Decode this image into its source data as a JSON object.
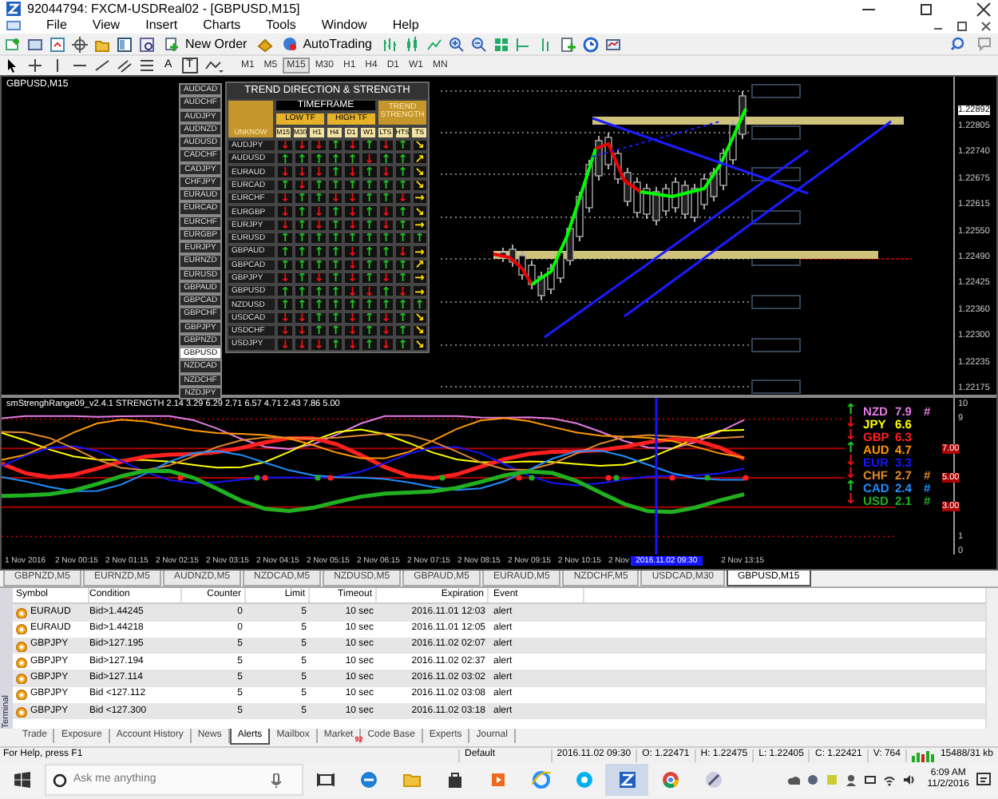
{
  "window": {
    "title": "92044794: FXCM-USDReal02 - [GBPUSD,M15]"
  },
  "menu": [
    "File",
    "View",
    "Insert",
    "Charts",
    "Tools",
    "Window",
    "Help"
  ],
  "toolbar": {
    "buttons": [
      "New Order",
      "AutoTrading"
    ],
    "text_tools": [
      "A",
      "T"
    ],
    "timeframes": [
      {
        "label": "M1",
        "selected": false
      },
      {
        "label": "M5",
        "selected": false
      },
      {
        "label": "M15",
        "selected": true
      },
      {
        "label": "M30",
        "selected": false
      },
      {
        "label": "H1",
        "selected": false
      },
      {
        "label": "H4",
        "selected": false
      },
      {
        "label": "D1",
        "selected": false
      },
      {
        "label": "W1",
        "selected": false
      },
      {
        "label": "MN",
        "selected": false
      }
    ]
  },
  "chart": {
    "symbol": "GBPUSD,M15",
    "price_axis": [
      "1.22892",
      "1.22805",
      "1.22740",
      "1.22675",
      "1.22615",
      "1.22550",
      "1.22490",
      "1.22425",
      "1.22360",
      "1.22300",
      "1.22235",
      "1.22175"
    ],
    "pair_buttons": [
      {
        "label": "AUDCAD",
        "selected": false
      },
      {
        "label": "AUDCHF",
        "selected": false
      },
      {
        "label": "AUDJPY",
        "selected": false
      },
      {
        "label": "AUDNZD",
        "selected": false
      },
      {
        "label": "AUDUSD",
        "selected": false
      },
      {
        "label": "CADCHF",
        "selected": false
      },
      {
        "label": "CADJPY",
        "selected": false
      },
      {
        "label": "CHFJPY",
        "selected": false
      },
      {
        "label": "EURAUD",
        "selected": false
      },
      {
        "label": "EURCAD",
        "selected": false
      },
      {
        "label": "EURCHF",
        "selected": false
      },
      {
        "label": "EURGBP",
        "selected": false
      },
      {
        "label": "EURJPY",
        "selected": false
      },
      {
        "label": "EURNZD",
        "selected": false
      },
      {
        "label": "EURUSD",
        "selected": false
      },
      {
        "label": "GBPAUD",
        "selected": false
      },
      {
        "label": "GBPCAD",
        "selected": false
      },
      {
        "label": "GBPCHF",
        "selected": false
      },
      {
        "label": "GBPJPY",
        "selected": false
      },
      {
        "label": "GBPNZD",
        "selected": false
      },
      {
        "label": "GBPUSD",
        "selected": true
      },
      {
        "label": "NZDCAD",
        "selected": false
      },
      {
        "label": "NZDCHF",
        "selected": false
      },
      {
        "label": "NZDJPY",
        "selected": false
      }
    ],
    "trend_table": {
      "title": "TREND DIRECTION & STRENGTH",
      "timeframe": "TIMEFRAME",
      "strength": "TREND STRENGTH",
      "low_tf": "LOW TF",
      "high_tf": "HIGH TF",
      "corner": "UNKNOW",
      "columns": [
        "M15",
        "M30",
        "H1",
        "H4",
        "D1",
        "W1",
        "LTS",
        "HTS",
        "TS"
      ],
      "rows": [
        {
          "pair": "AUDJPY",
          "arrows": [
            "↓",
            "↓",
            "↓",
            "↑",
            "↓",
            "↑",
            "↓",
            "↑"
          ],
          "ts": "↘"
        },
        {
          "pair": "AUDUSD",
          "arrows": [
            "↑",
            "↑",
            "↑",
            "↑",
            "↑",
            "↓",
            "↑",
            "↑"
          ],
          "ts": "↗"
        },
        {
          "pair": "EURAUD",
          "arrows": [
            "↓",
            "↓",
            "↓",
            "↑",
            "↓",
            "↑",
            "↓",
            "↑"
          ],
          "ts": "↘"
        },
        {
          "pair": "EURCAD",
          "arrows": [
            "↑",
            "↓",
            "↑",
            "↑",
            "↑",
            "↑",
            "↑",
            "↑"
          ],
          "ts": "↘"
        },
        {
          "pair": "EURCHF",
          "arrows": [
            "↓",
            "↑",
            "↑",
            "↓",
            "↓",
            "↑",
            "↑",
            "↓"
          ],
          "ts": "→"
        },
        {
          "pair": "EURGBP",
          "arrows": [
            "↓",
            "↑",
            "↓",
            "↑",
            "↓",
            "↑",
            "↓",
            "↑"
          ],
          "ts": "↘"
        },
        {
          "pair": "EURJPY",
          "arrows": [
            "↓",
            "↑",
            "↓",
            "↑",
            "↓",
            "↑",
            "↓",
            "↑"
          ],
          "ts": "→"
        },
        {
          "pair": "EURUSD",
          "arrows": [
            "↑",
            "↑",
            "↑",
            "↑",
            "↑",
            "↑",
            "↑",
            "↑"
          ],
          "ts": "↑"
        },
        {
          "pair": "GBPAUD",
          "arrows": [
            "↑",
            "↑",
            "↑",
            "↑",
            "↓",
            "↑",
            "↑",
            "↓"
          ],
          "ts": "→"
        },
        {
          "pair": "GBPCAD",
          "arrows": [
            "↑",
            "↑",
            "↑",
            "↑",
            "↓",
            "↑",
            "↑",
            "↑"
          ],
          "ts": "↗"
        },
        {
          "pair": "GBPJPY",
          "arrows": [
            "↓",
            "↑",
            "↓",
            "↑",
            "↓",
            "↑",
            "↓",
            "↑"
          ],
          "ts": "→"
        },
        {
          "pair": "GBPUSD",
          "arrows": [
            "↑",
            "↑",
            "↑",
            "↑",
            "↓",
            "↓",
            "↑",
            "↓"
          ],
          "ts": "→"
        },
        {
          "pair": "NZDUSD",
          "arrows": [
            "↑",
            "↑",
            "↑",
            "↑",
            "↑",
            "↑",
            "↑",
            "↑"
          ],
          "ts": "↑"
        },
        {
          "pair": "USDCAD",
          "arrows": [
            "↓",
            "↓",
            "↑",
            "↑",
            "↓",
            "↑",
            "↓",
            "↑"
          ],
          "ts": "↘"
        },
        {
          "pair": "USDCHF",
          "arrows": [
            "↓",
            "↓",
            "↑",
            "↑",
            "↓",
            "↑",
            "↓",
            "↑"
          ],
          "ts": "↘"
        },
        {
          "pair": "USDJPY",
          "arrows": [
            "↓",
            "↓",
            "↓",
            "↑",
            "↓",
            "↑",
            "↓",
            "↑"
          ],
          "ts": "↘"
        }
      ]
    }
  },
  "indicator": {
    "label": "smStrenghRange09_v2.4.1 STRENGTH  2.14 3.29 6.29 2.71 6.57 4.71 2.43 7.86 5.00",
    "axis": [
      "10",
      "9",
      "7.00",
      "5.00",
      "3.00",
      "1",
      "0"
    ],
    "legend": [
      {
        "code": "NZD",
        "value": "7.9",
        "mark": "#",
        "trend": "↑",
        "color": "#e47ce4"
      },
      {
        "code": "JPY",
        "value": "6.6",
        "trend": "↓",
        "color": "#ffff00"
      },
      {
        "code": "GBP",
        "value": "6.3",
        "trend": "↓",
        "color": "#ff2020"
      },
      {
        "code": "AUD",
        "value": "4.7",
        "trend": "↑",
        "color": "#ff9900"
      },
      {
        "code": "EUR",
        "value": "3.3",
        "trend": "↓",
        "color": "#1414ff"
      },
      {
        "code": "CHF",
        "value": "2.7",
        "mark": "#",
        "trend": "↓",
        "color": "#e08a2c"
      },
      {
        "code": "CAD",
        "value": "2.4",
        "mark": "#",
        "trend": "↑",
        "color": "#1e90ff"
      },
      {
        "code": "USD",
        "value": "2.1",
        "mark": "#",
        "trend": "↓",
        "color": "#20b020"
      }
    ]
  },
  "time_axis": [
    {
      "kind": "tick",
      "text": "1 Nov 2016"
    },
    {
      "kind": "tick",
      "text": "2 Nov 00:15"
    },
    {
      "kind": "tick",
      "text": "2 Nov 01:15"
    },
    {
      "kind": "tick",
      "text": "2 Nov 02:15"
    },
    {
      "kind": "tick",
      "text": "2 Nov 03:15"
    },
    {
      "kind": "tick",
      "text": "2 Nov 04:15"
    },
    {
      "kind": "tick",
      "text": "2 Nov 05:15"
    },
    {
      "kind": "tick",
      "text": "2 Nov 06:15"
    },
    {
      "kind": "tick",
      "text": "2 Nov 07:15"
    },
    {
      "kind": "tick",
      "text": "2 Nov 08:15"
    },
    {
      "kind": "tick",
      "text": "2 Nov 09:15"
    },
    {
      "kind": "tick",
      "text": "2 Nov 10:15"
    },
    {
      "kind": "tick",
      "text": "2 Nov"
    },
    {
      "kind": "cursor",
      "text": "2016.11.02 09:30"
    },
    {
      "kind": "tick",
      "text": "2 Nov 13:15"
    }
  ],
  "chart_tabs": [
    {
      "label": "GBPNZD,M5",
      "selected": false
    },
    {
      "label": "EURNZD,M5",
      "selected": false
    },
    {
      "label": "AUDNZD,M5",
      "selected": false
    },
    {
      "label": "NZDCAD,M5",
      "selected": false
    },
    {
      "label": "NZDUSD,M5",
      "selected": false
    },
    {
      "label": "GBPAUD,M5",
      "selected": false
    },
    {
      "label": "EURAUD,M5",
      "selected": false
    },
    {
      "label": "NZDCHF,M5",
      "selected": false
    },
    {
      "label": "USDCAD,M30",
      "selected": false
    },
    {
      "label": "GBPUSD,M15",
      "selected": true
    }
  ],
  "terminal": {
    "label": "Terminal",
    "columns": [
      "Symbol",
      "Condition",
      "Counter",
      "Limit",
      "Timeout",
      "Expiration",
      "Event"
    ],
    "rows": [
      [
        "EURAUD",
        "Bid>1.44245",
        "0",
        "5",
        "10 sec",
        "2016.11.01 12:03",
        "alert"
      ],
      [
        "EURAUD",
        "Bid>1.44218",
        "0",
        "5",
        "10 sec",
        "2016.11.01 12:05",
        "alert"
      ],
      [
        "GBPJPY",
        "Bid>127.195",
        "5",
        "5",
        "10 sec",
        "2016.11.02 02:07",
        "alert"
      ],
      [
        "GBPJPY",
        "Bid>127.194",
        "5",
        "5",
        "10 sec",
        "2016.11.02 02:37",
        "alert"
      ],
      [
        "GBPJPY",
        "Bid>127.114",
        "5",
        "5",
        "10 sec",
        "2016.11.02 03:02",
        "alert"
      ],
      [
        "GBPJPY",
        "Bid <127.112",
        "5",
        "5",
        "10 sec",
        "2016.11.02 03:08",
        "alert"
      ],
      [
        "GBPJPY",
        "Bid <127.300",
        "5",
        "5",
        "10 sec",
        "2016.11.02 03:18",
        "alert"
      ]
    ],
    "tabs": [
      {
        "label": "Trade",
        "selected": false
      },
      {
        "label": "Exposure",
        "selected": false
      },
      {
        "label": "Account History",
        "selected": false
      },
      {
        "label": "News",
        "selected": false
      },
      {
        "label": "Alerts",
        "selected": true
      },
      {
        "label": "Mailbox",
        "selected": false
      },
      {
        "label": "Market",
        "selected": false,
        "badge": "92"
      },
      {
        "label": "Code Base",
        "selected": false
      },
      {
        "label": "Experts",
        "selected": false
      },
      {
        "label": "Journal",
        "selected": false
      }
    ]
  },
  "status_bar": {
    "help": "For Help, press F1",
    "fields": [
      "Default",
      "2016.11.02 09:30",
      "O: 1.22471",
      "H: 1.22475",
      "L: 1.22405",
      "C: 1.22421",
      "V: 764"
    ],
    "traffic": "15488/31 kb"
  },
  "taskbar": {
    "search_placeholder": "Ask me anything",
    "time": "6:09 AM",
    "date": "11/2/2016"
  }
}
